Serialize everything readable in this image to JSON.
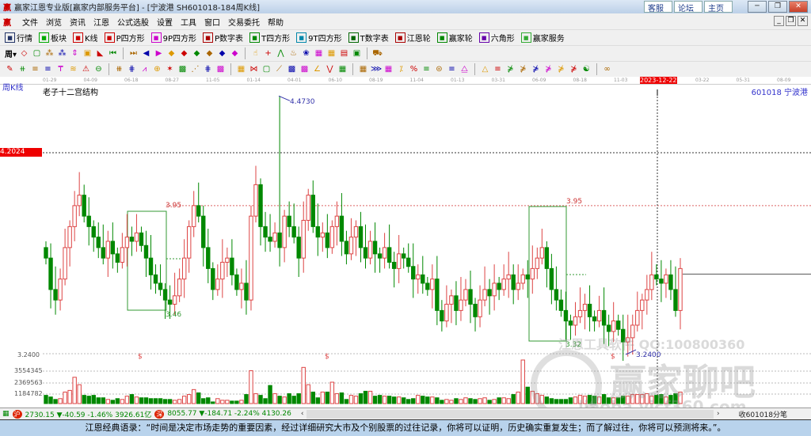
{
  "window": {
    "title": "赢家江恩专业版[赢家内部服务平台] - [宁波港  SH601018-184周K线]",
    "links": [
      "客服",
      "论坛",
      "主页"
    ]
  },
  "menu": [
    "文件",
    "浏览",
    "资讯",
    "江恩",
    "公式选股",
    "设置",
    "工具",
    "窗口",
    "交易委托",
    "帮助"
  ],
  "toolbar1": [
    {
      "icon": "grid-icon",
      "label": "行情",
      "c": "#236"
    },
    {
      "icon": "blocks-icon",
      "label": "板块",
      "c": "#0a0"
    },
    {
      "icon": "kline-icon",
      "label": "K线",
      "c": "#c00"
    },
    {
      "icon": "ps-icon",
      "label": "P四方形",
      "c": "#c00"
    },
    {
      "icon": "p9-icon",
      "label": "9P四方形",
      "c": "#c0c"
    },
    {
      "icon": "pn-icon",
      "label": "P数字表",
      "c": "#a00"
    },
    {
      "icon": "ts-icon",
      "label": "T四方形",
      "c": "#080"
    },
    {
      "icon": "t9-icon",
      "label": "9T四方形",
      "c": "#08a"
    },
    {
      "icon": "tn-icon",
      "label": "T数字表",
      "c": "#060"
    },
    {
      "icon": "wheel-icon",
      "label": "江恩轮",
      "c": "#a00"
    },
    {
      "icon": "winner-wheel-icon",
      "label": "赢家轮",
      "c": "#080"
    },
    {
      "icon": "hexagon-icon",
      "label": "六角形",
      "c": "#60a"
    },
    {
      "icon": "dollar-icon",
      "label": "赢家服务",
      "c": "#3a3"
    }
  ],
  "toolbar2": {
    "period": "周",
    "icons": [
      "◇",
      "▢",
      "⁂",
      "⁂",
      "⇕",
      "▣",
      "◣",
      "⏮",
      "⏭",
      "◀",
      "▶",
      "◆",
      "◆",
      "◆",
      "◆",
      "◆",
      "◆",
      "☝",
      "+",
      "⋀",
      "♨",
      "❀",
      "▦",
      "▦",
      "▤",
      "▣",
      "⛟"
    ]
  },
  "toolbar3": {
    "icons": [
      "✎",
      "⧺",
      "≡",
      "≡",
      "₸",
      "≋",
      "⚠",
      "⊖",
      "⧻",
      "⋕",
      "⩘",
      "⊕",
      "✶",
      "▩",
      "⋰",
      "⋕",
      "▩",
      "▦",
      "⋈",
      "▢",
      "⟋",
      "▩",
      "▩",
      "∠",
      "⋁",
      "▦",
      "▦",
      "⋙",
      "▦",
      "⁒",
      "%",
      "≡",
      "⊜",
      "≡",
      "⧋",
      "△",
      "≡",
      "⋡",
      "⋡",
      "⋡",
      "⋡",
      "⋡",
      "⋡",
      "☯",
      "∞"
    ]
  },
  "date_axis": [
    "01-29",
    "04-09",
    "06-18",
    "08-27",
    "11-05",
    "01-14",
    "04-01",
    "06-10",
    "08-19",
    "11-04",
    "01-13",
    "03-31",
    "06-09",
    "08-18",
    "11-03",
    "2023-12-22",
    "03-22",
    "05-31",
    "08-09"
  ],
  "chart_data": {
    "type": "candlestick",
    "period_label": "周K线",
    "indicator_name": "老子十二宫结构",
    "symbol": "601018  宁波港",
    "high_label": "4.4730",
    "low_label": "3.2400",
    "cursor_price": "4.2024",
    "level_395": "3.95",
    "box1_low": "3.46",
    "box2_low": "3.32",
    "price_range": [
      3.18,
      4.5
    ],
    "closes": [
      3.7,
      3.55,
      3.5,
      3.6,
      3.75,
      3.85,
      3.95,
      4.0,
      3.9,
      3.85,
      3.8,
      3.75,
      3.7,
      3.78,
      3.72,
      3.68,
      3.75,
      3.8,
      3.78,
      3.82,
      3.76,
      3.7,
      3.62,
      3.58,
      3.55,
      3.5,
      3.48,
      3.52,
      3.6,
      3.7,
      3.85,
      3.95,
      3.9,
      3.75,
      3.65,
      3.55,
      3.6,
      3.68,
      3.7,
      3.62,
      3.55,
      3.58,
      3.5,
      3.9,
      4.05,
      3.85,
      3.8,
      3.78,
      3.82,
      3.75,
      3.9,
      3.85,
      3.8,
      3.7,
      3.88,
      4.0,
      3.85,
      3.8,
      3.82,
      3.75,
      3.85,
      3.9,
      3.78,
      3.72,
      3.8,
      3.85,
      3.75,
      3.7,
      3.78,
      3.72,
      3.7,
      3.75,
      3.68,
      3.65,
      3.72,
      3.7,
      3.66,
      3.6,
      3.62,
      3.58,
      3.55,
      3.6,
      3.45,
      3.4,
      3.48,
      3.52,
      3.45,
      3.5,
      3.55,
      3.48,
      3.42,
      3.5,
      3.55,
      3.52,
      3.58,
      3.55,
      3.6,
      3.62,
      3.55,
      3.58,
      3.62,
      3.6,
      3.65,
      3.7,
      3.75,
      3.65,
      3.55,
      3.5,
      3.45,
      3.4,
      3.38,
      3.42,
      3.45,
      3.48,
      3.42,
      3.4,
      3.45,
      3.38,
      3.35,
      3.4,
      3.36,
      3.3,
      3.32,
      3.38,
      3.45,
      3.5,
      3.55,
      3.62,
      3.6,
      3.58,
      3.62,
      3.55,
      3.45,
      3.65
    ],
    "volume_ticks": [
      "3554345",
      "2369563",
      "1184782"
    ],
    "volume_top_label": "3.2400",
    "volumes": [
      1.0,
      0.8,
      0.5,
      0.6,
      1.4,
      1.6,
      3.2,
      2.3,
      1.0,
      0.9,
      1.0,
      0.7,
      0.7,
      0.5,
      0.4,
      0.6,
      0.5,
      0.9,
      1.1,
      0.8,
      0.7,
      0.7,
      0.6,
      0.6,
      0.6,
      0.5,
      0.5,
      0.4,
      0.5,
      0.9,
      1.1,
      1.7,
      1.3,
      0.6,
      0.7,
      0.2,
      0.6,
      0.4,
      0.4,
      0.3,
      0.3,
      0.4,
      1.1,
      4.0,
      1.2,
      1.0,
      0.6,
      2.2,
      1.2,
      0.9,
      0.8,
      1.2,
      0.9,
      1.2,
      4.4,
      2.3,
      1.4,
      0.7,
      1.4,
      1.4,
      2.6,
      1.2,
      1.3,
      0.5,
      1.0,
      0.9,
      1.2,
      1.5,
      1.5,
      0.9,
      1.0,
      0.9,
      0.9,
      0.8,
      0.8,
      0.7,
      0.5,
      0.6,
      1.0,
      0.9,
      0.8,
      0.8,
      0.7,
      0.4,
      0.5,
      0.4,
      0.6,
      0.5,
      0.7,
      0.6,
      0.5,
      0.6,
      0.7,
      0.4,
      0.5,
      0.7,
      0.7,
      0.6,
      1.1,
      1.4,
      5.3,
      2.0,
      1.5,
      1.2,
      1.0,
      0.8,
      0.6,
      0.5,
      0.5,
      0.5,
      0.7,
      0.8,
      1.0,
      0.9,
      1.0,
      0.9,
      0.8,
      1.1,
      0.7,
      0.7,
      0.7,
      0.9,
      0.9,
      1.1,
      1.1,
      1.1,
      1.2,
      0.9,
      1.0,
      1.1,
      0.8,
      1.0,
      1.2,
      1.4
    ]
  },
  "watermark": {
    "line1": "江恩工具软件  QQ:100800360",
    "line2": "赢家聊吧",
    "line3": "liaoba.vicf360.com"
  },
  "status": {
    "sh": "2730.15 ▼-40.59 -1.46% 3926.61亿",
    "sz": "8055.77 ▼-184.71 -2.24% 4130.26",
    "right": "收601018分笔",
    "sh_badge": "沪",
    "sz_badge": "深"
  },
  "quote": "江恩经典语录：“时间是决定市场走势的重要因素，经过详细研究大市及个别股票的过往记录，你将可以证明，历史确实重复发生；而了解过往，你将可以预测将来。”。"
}
